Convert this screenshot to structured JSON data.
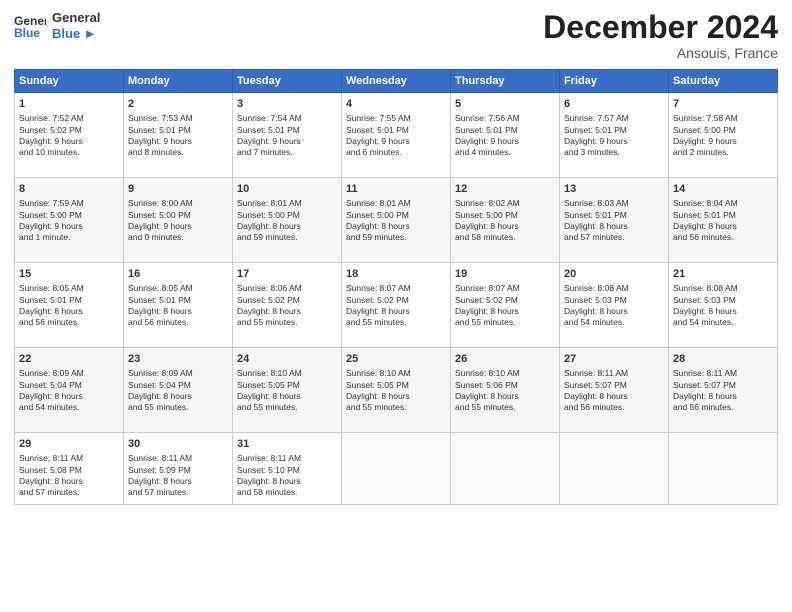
{
  "header": {
    "logo_line1": "General",
    "logo_line2": "Blue",
    "month": "December 2024",
    "location": "Ansouis, France"
  },
  "days_of_week": [
    "Sunday",
    "Monday",
    "Tuesday",
    "Wednesday",
    "Thursday",
    "Friday",
    "Saturday"
  ],
  "weeks": [
    [
      {
        "day": "1",
        "info": "Sunrise: 7:52 AM\nSunset: 5:02 PM\nDaylight: 9 hours\nand 10 minutes."
      },
      {
        "day": "2",
        "info": "Sunrise: 7:53 AM\nSunset: 5:01 PM\nDaylight: 9 hours\nand 8 minutes."
      },
      {
        "day": "3",
        "info": "Sunrise: 7:54 AM\nSunset: 5:01 PM\nDaylight: 9 hours\nand 7 minutes."
      },
      {
        "day": "4",
        "info": "Sunrise: 7:55 AM\nSunset: 5:01 PM\nDaylight: 9 hours\nand 6 minutes."
      },
      {
        "day": "5",
        "info": "Sunrise: 7:56 AM\nSunset: 5:01 PM\nDaylight: 9 hours\nand 4 minutes."
      },
      {
        "day": "6",
        "info": "Sunrise: 7:57 AM\nSunset: 5:01 PM\nDaylight: 9 hours\nand 3 minutes."
      },
      {
        "day": "7",
        "info": "Sunrise: 7:58 AM\nSunset: 5:00 PM\nDaylight: 9 hours\nand 2 minutes."
      }
    ],
    [
      {
        "day": "8",
        "info": "Sunrise: 7:59 AM\nSunset: 5:00 PM\nDaylight: 9 hours\nand 1 minute."
      },
      {
        "day": "9",
        "info": "Sunrise: 8:00 AM\nSunset: 5:00 PM\nDaylight: 9 hours\nand 0 minutes."
      },
      {
        "day": "10",
        "info": "Sunrise: 8:01 AM\nSunset: 5:00 PM\nDaylight: 8 hours\nand 59 minutes."
      },
      {
        "day": "11",
        "info": "Sunrise: 8:01 AM\nSunset: 5:00 PM\nDaylight: 8 hours\nand 59 minutes."
      },
      {
        "day": "12",
        "info": "Sunrise: 8:02 AM\nSunset: 5:00 PM\nDaylight: 8 hours\nand 58 minutes."
      },
      {
        "day": "13",
        "info": "Sunrise: 8:03 AM\nSunset: 5:01 PM\nDaylight: 8 hours\nand 57 minutes."
      },
      {
        "day": "14",
        "info": "Sunrise: 8:04 AM\nSunset: 5:01 PM\nDaylight: 8 hours\nand 56 minutes."
      }
    ],
    [
      {
        "day": "15",
        "info": "Sunrise: 8:05 AM\nSunset: 5:01 PM\nDaylight: 8 hours\nand 56 minutes."
      },
      {
        "day": "16",
        "info": "Sunrise: 8:05 AM\nSunset: 5:01 PM\nDaylight: 8 hours\nand 56 minutes."
      },
      {
        "day": "17",
        "info": "Sunrise: 8:06 AM\nSunset: 5:02 PM\nDaylight: 8 hours\nand 55 minutes."
      },
      {
        "day": "18",
        "info": "Sunrise: 8:07 AM\nSunset: 5:02 PM\nDaylight: 8 hours\nand 55 minutes."
      },
      {
        "day": "19",
        "info": "Sunrise: 8:07 AM\nSunset: 5:02 PM\nDaylight: 8 hours\nand 55 minutes."
      },
      {
        "day": "20",
        "info": "Sunrise: 8:08 AM\nSunset: 5:03 PM\nDaylight: 8 hours\nand 54 minutes."
      },
      {
        "day": "21",
        "info": "Sunrise: 8:08 AM\nSunset: 5:03 PM\nDaylight: 8 hours\nand 54 minutes."
      }
    ],
    [
      {
        "day": "22",
        "info": "Sunrise: 8:09 AM\nSunset: 5:04 PM\nDaylight: 8 hours\nand 54 minutes."
      },
      {
        "day": "23",
        "info": "Sunrise: 8:09 AM\nSunset: 5:04 PM\nDaylight: 8 hours\nand 55 minutes."
      },
      {
        "day": "24",
        "info": "Sunrise: 8:10 AM\nSunset: 5:05 PM\nDaylight: 8 hours\nand 55 minutes."
      },
      {
        "day": "25",
        "info": "Sunrise: 8:10 AM\nSunset: 5:05 PM\nDaylight: 8 hours\nand 55 minutes."
      },
      {
        "day": "26",
        "info": "Sunrise: 8:10 AM\nSunset: 5:06 PM\nDaylight: 8 hours\nand 55 minutes."
      },
      {
        "day": "27",
        "info": "Sunrise: 8:11 AM\nSunset: 5:07 PM\nDaylight: 8 hours\nand 56 minutes."
      },
      {
        "day": "28",
        "info": "Sunrise: 8:11 AM\nSunset: 5:07 PM\nDaylight: 8 hours\nand 56 minutes."
      }
    ],
    [
      {
        "day": "29",
        "info": "Sunrise: 8:11 AM\nSunset: 5:08 PM\nDaylight: 8 hours\nand 57 minutes."
      },
      {
        "day": "30",
        "info": "Sunrise: 8:11 AM\nSunset: 5:09 PM\nDaylight: 8 hours\nand 57 minutes."
      },
      {
        "day": "31",
        "info": "Sunrise: 8:11 AM\nSunset: 5:10 PM\nDaylight: 8 hours\nand 58 minutes."
      },
      {
        "day": "",
        "info": ""
      },
      {
        "day": "",
        "info": ""
      },
      {
        "day": "",
        "info": ""
      },
      {
        "day": "",
        "info": ""
      }
    ]
  ]
}
